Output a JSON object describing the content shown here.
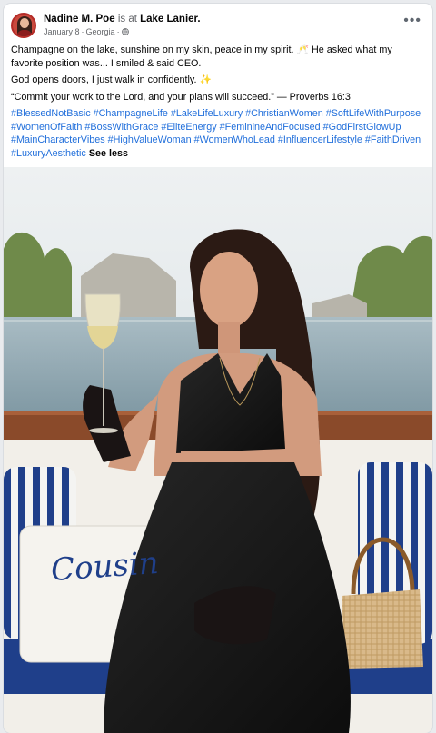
{
  "post": {
    "author": "Nadine M. Poe",
    "is_at": "is at",
    "location": "Lake Lanier.",
    "date": "January 8",
    "separator": "·",
    "place": "Georgia",
    "separator2": "·",
    "more_icon": "more-dots-icon",
    "line1_a": "Champagne on the lake, sunshine on my skin, peace in my spirit.",
    "line1_emoji": "🥂",
    "line1_b": "He asked what my favorite position was... I smiled & said CEO.",
    "line2": "God opens doors, I just walk in confidently.",
    "line2_emoji": "✨",
    "line3": "“Commit your work to the Lord, and your plans will succeed.” — Proverbs 16:3",
    "hashtags": "#BlessedNotBasic #ChampagneLife #LakeLifeLuxury #ChristianWomen #SoftLifeWithPurpose #WomenOfFaith #BossWithGrace #EliteEnergy #FeminineAndFocused #GodFirstGlowUp #MainCharacterVibes #HighValueWoman #WomenWhoLead #InfluencerLifestyle #FaithDriven #LuxuryAesthetic",
    "see_less": "See less"
  },
  "photo": {
    "pillow_text": "Cousin",
    "colors": {
      "sky": "#dfe6ea",
      "water": "#9fb4bd",
      "dress": "#141414",
      "stripes": "#1f3f8a",
      "wood": "#8a4a2a"
    }
  },
  "colors": {
    "link": "#216fdb",
    "text": "#050505",
    "muted": "#65676b"
  }
}
